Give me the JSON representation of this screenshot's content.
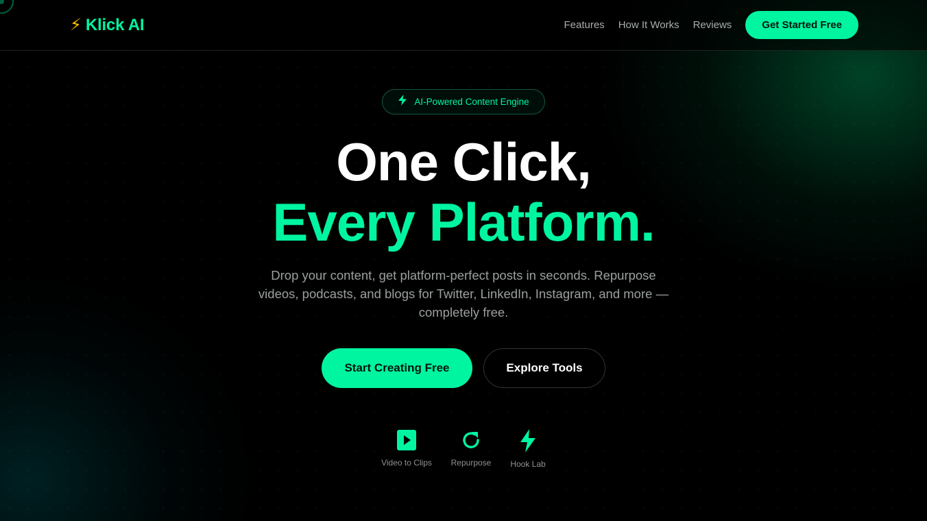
{
  "brand": {
    "icon": "lightning-emoji",
    "name": "Klick AI"
  },
  "nav": {
    "links": [
      "Features",
      "How It Works",
      "Reviews"
    ],
    "cta_label": "Get Started Free"
  },
  "hero": {
    "badge": {
      "icon": "bolt-icon",
      "text": "AI-Powered Content Engine"
    },
    "title_line1": "One Click,",
    "title_line2": "Every Platform.",
    "subtitle": "Drop your content, get platform-perfect posts in seconds. Repurpose videos, podcasts, and blogs for Twitter, LinkedIn, Instagram, and more — completely free.",
    "primary_cta": "Start Creating Free",
    "secondary_cta": "Explore Tools"
  },
  "tools": [
    {
      "icon": "play-square-icon",
      "label": "Video to Clips"
    },
    {
      "icon": "refresh-icon",
      "label": "Repurpose"
    },
    {
      "icon": "bolt-icon",
      "label": "Hook Lab"
    }
  ],
  "colors": {
    "accent": "#00f5a0",
    "background": "#000000",
    "muted_text": "#9aa09d"
  }
}
